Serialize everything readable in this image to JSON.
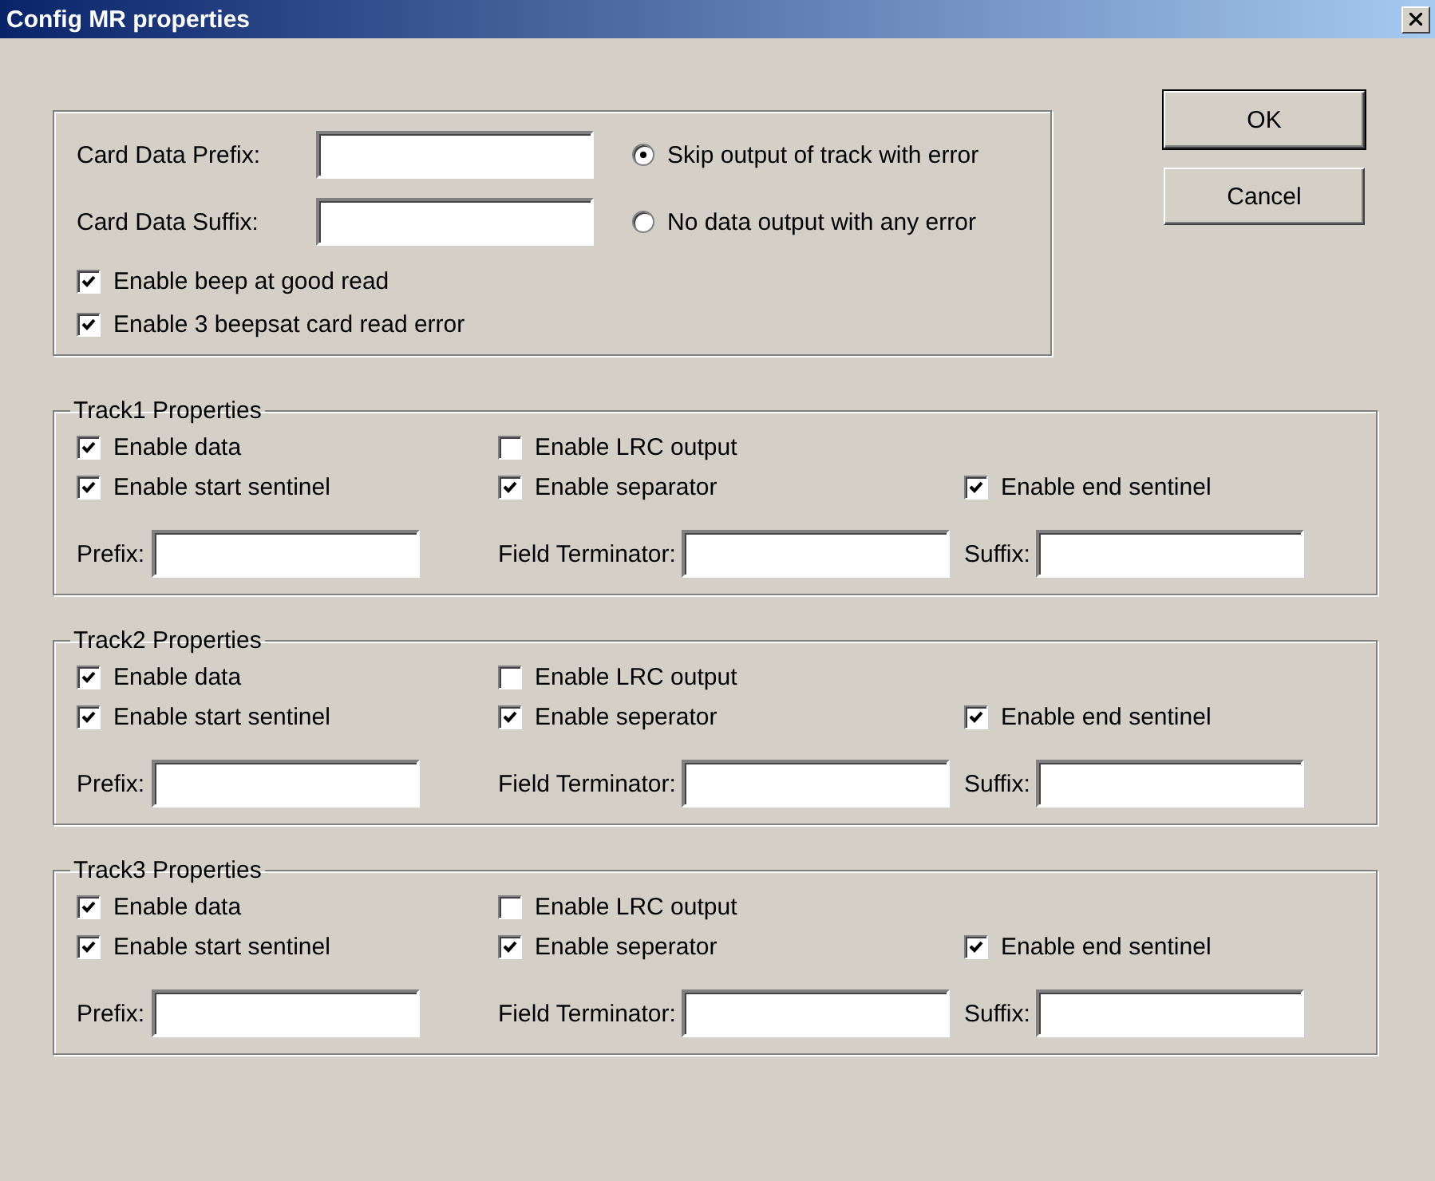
{
  "window": {
    "title": "Config MR properties"
  },
  "general": {
    "fields": [
      {
        "label": "Card Data Prefix:"
      },
      {
        "label": "Card Data Suffix:"
      }
    ],
    "radios": [
      {
        "label": "Skip output of track with error",
        "selected": true
      },
      {
        "label": "No data output with any error",
        "selected": false
      }
    ],
    "checkboxes": [
      {
        "label": "Enable beep at good read",
        "checked": true
      },
      {
        "label": "Enable 3 beepsat card read error",
        "checked": true
      }
    ]
  },
  "buttons": [
    {
      "label": "OK",
      "default": true
    },
    {
      "label": "Cancel",
      "default": false
    }
  ],
  "tracks": [
    {
      "title": "Track1 Properties",
      "checkbox_rows": [
        [
          {
            "label": "Enable data",
            "checked": true
          },
          {
            "label": "Enable LRC output",
            "checked": false
          }
        ],
        [
          {
            "label": "Enable start sentinel",
            "checked": true
          },
          {
            "label": "Enable separator",
            "checked": true
          },
          {
            "label": "Enable end sentinel",
            "checked": true
          }
        ]
      ],
      "fields": [
        {
          "label": "Prefix:"
        },
        {
          "label": "Field Terminator:"
        },
        {
          "label": "Suffix:"
        }
      ]
    },
    {
      "title": "Track2 Properties",
      "checkbox_rows": [
        [
          {
            "label": "Enable data",
            "checked": true
          },
          {
            "label": "Enable LRC output",
            "checked": false
          }
        ],
        [
          {
            "label": "Enable start sentinel",
            "checked": true
          },
          {
            "label": "Enable seperator",
            "checked": true
          },
          {
            "label": "Enable end sentinel",
            "checked": true
          }
        ]
      ],
      "fields": [
        {
          "label": "Prefix:"
        },
        {
          "label": "Field Terminator:"
        },
        {
          "label": "Suffix:"
        }
      ]
    },
    {
      "title": "Track3 Properties",
      "checkbox_rows": [
        [
          {
            "label": "Enable data",
            "checked": true
          },
          {
            "label": "Enable LRC output",
            "checked": false
          }
        ],
        [
          {
            "label": "Enable start sentinel",
            "checked": true
          },
          {
            "label": "Enable seperator",
            "checked": true
          },
          {
            "label": "Enable end sentinel",
            "checked": true
          }
        ]
      ],
      "fields": [
        {
          "label": "Prefix:"
        },
        {
          "label": "Field Terminator:"
        },
        {
          "label": "Suffix:"
        }
      ]
    }
  ]
}
